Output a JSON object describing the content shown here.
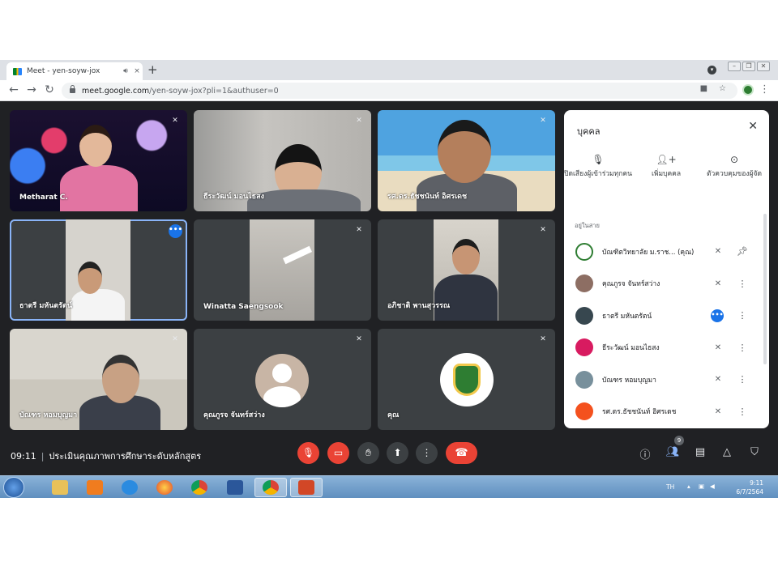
{
  "browser": {
    "tab_title": "Meet - yen-soyw-jox",
    "tab_audio_icon": "speaker-icon",
    "tab_close": "×",
    "new_tab": "+",
    "url_host": "meet.google.com",
    "url_path": "/yen-soyw-jox?pli=1&authuser=0"
  },
  "tiles": [
    {
      "name": "Metharat C.",
      "muted": true
    },
    {
      "name": "ธีระวัฒน์ มอนไธสง",
      "muted": true
    },
    {
      "name": "รศ.ดร.ธัชชนันท์ อิศรเดช",
      "muted": true
    },
    {
      "name": "ธาตรี มหันตรัตน์",
      "muted": false,
      "menu": "•••"
    },
    {
      "name": "Winatta Saengsook",
      "muted": true
    },
    {
      "name": "อภิชาติ พานสุวรรณ",
      "muted": true
    },
    {
      "name": "บัณฑร หอมบุญมา",
      "muted": true
    },
    {
      "name": "คุณภูรจ จันทร์สว่าง",
      "muted": true
    },
    {
      "name": "คุณ",
      "muted": true
    }
  ],
  "people_panel": {
    "title": "บุคคล",
    "close": "✕",
    "actions": [
      {
        "icon": "mic-off-icon",
        "label": "ปิดเสียงผู้เข้าร่วมทุกคน"
      },
      {
        "icon": "add-person-icon",
        "label": "เพิ่มบุคคล"
      },
      {
        "icon": "toggle-icon",
        "label": "ตัวควบคุมของผู้จัด"
      }
    ],
    "section_label": "อยู่ในสาย",
    "participants": [
      {
        "name": "บัณฑิตวิทยาลัย ม.ราช...  (คุณ)",
        "avatar_color": "#2e7d32",
        "status": "muted",
        "trailing": "pin"
      },
      {
        "name": "คุณภูรจ จันทร์สว่าง",
        "avatar_color": "#8d6e63",
        "status": "muted",
        "trailing": "menu"
      },
      {
        "name": "ธาตรี มหันตรัตน์",
        "avatar_color": "#37474f",
        "status": "speaking",
        "trailing": "menu"
      },
      {
        "name": "ธีระวัฒน์ มอนไธสง",
        "avatar_color": "#d81b60",
        "status": "muted",
        "trailing": "menu"
      },
      {
        "name": "บัณฑร หอมบุญมา",
        "avatar_color": "#78909c",
        "status": "muted",
        "trailing": "menu"
      },
      {
        "name": "รศ.ดร.ธัชชนันท์ อิศรเดช",
        "avatar_color": "#f4511e",
        "status": "muted",
        "trailing": "menu"
      }
    ]
  },
  "bottom_bar": {
    "time": "09:11",
    "separator": "|",
    "meeting_title": "ประเมินคุณภาพการศึกษาระดับหลักสูตร",
    "participant_count": "9"
  },
  "taskbar": {
    "lang": "TH",
    "clock_time": "9:11",
    "clock_date": "6/7/2564"
  },
  "colors": {
    "meet_bg": "#202124",
    "tile_bg": "#3c4043",
    "danger": "#ea4335",
    "accent": "#1a73e8"
  }
}
